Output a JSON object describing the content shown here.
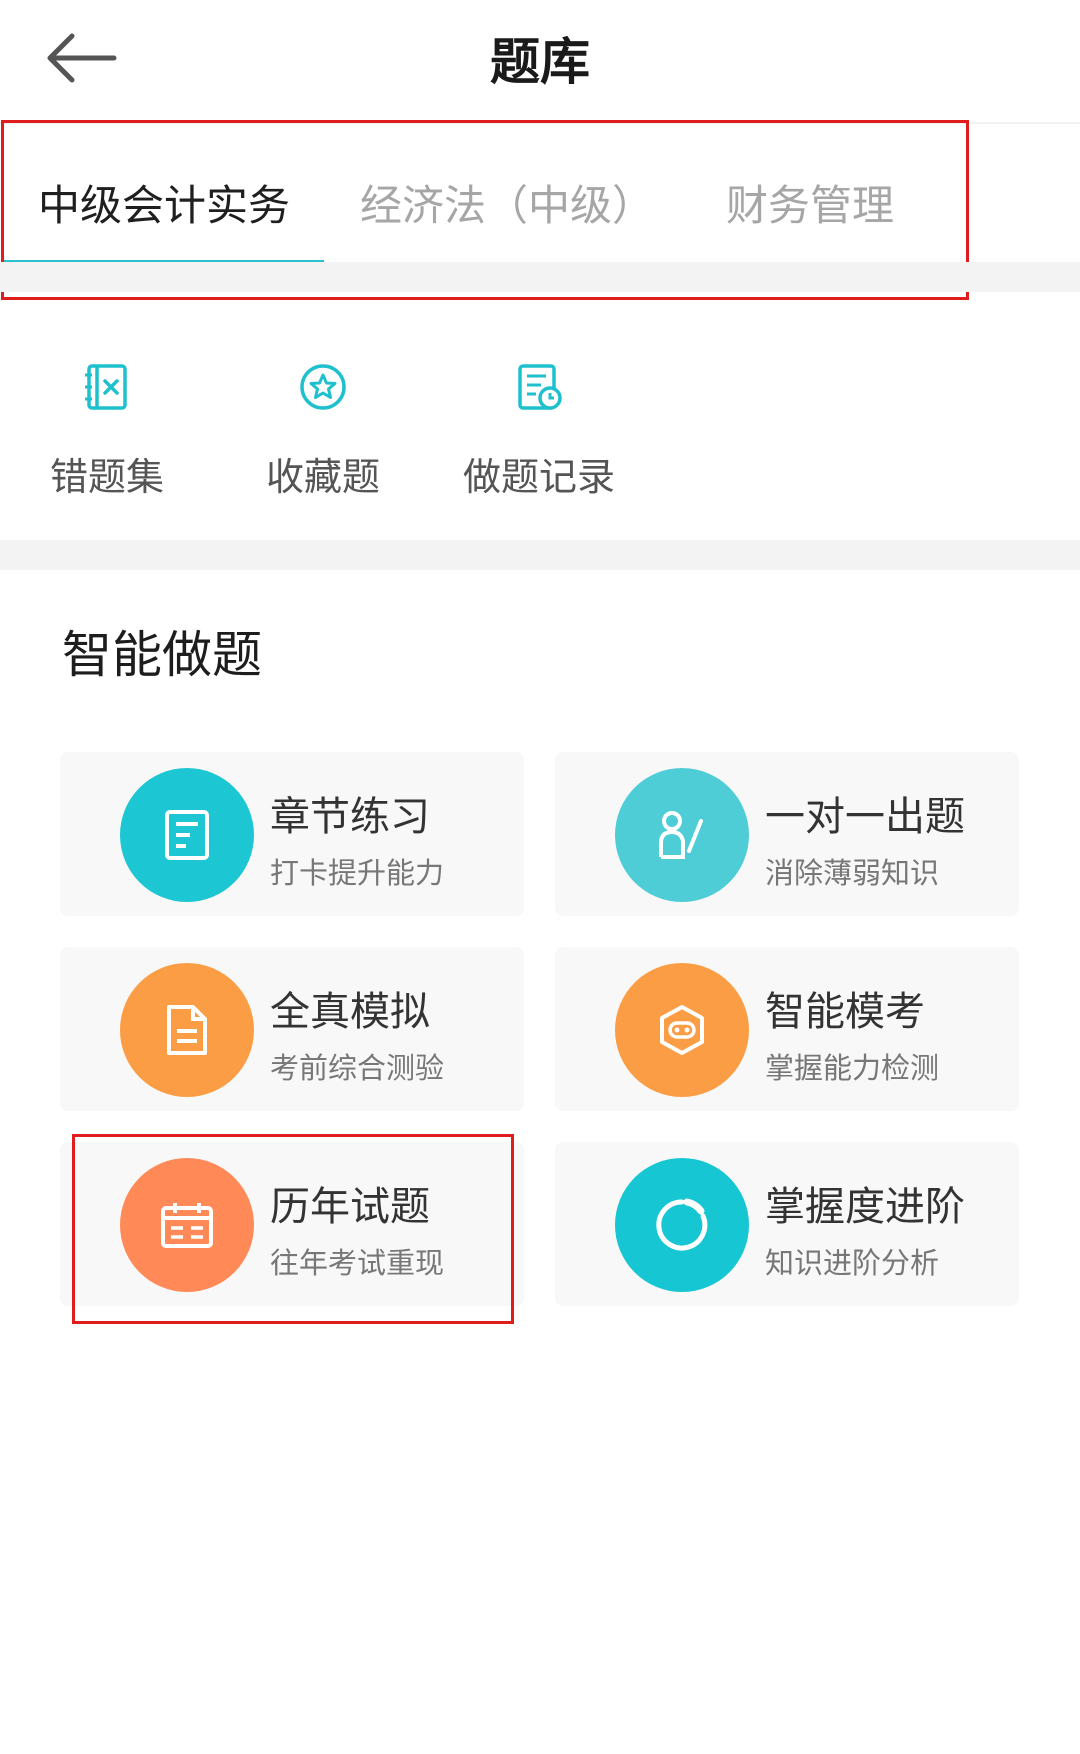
{
  "header": {
    "title": "题库"
  },
  "tabs": [
    {
      "label": "中级会计实务",
      "active": true
    },
    {
      "label": "经济法（中级）",
      "active": false
    },
    {
      "label": "财务管理",
      "active": false
    }
  ],
  "quick_actions": [
    {
      "label": "错题集",
      "icon": "error-notebook-icon"
    },
    {
      "label": "收藏题",
      "icon": "star-circle-icon"
    },
    {
      "label": "做题记录",
      "icon": "record-clock-icon"
    }
  ],
  "section": {
    "title": "智能做题"
  },
  "cards": [
    {
      "title": "章节练习",
      "subtitle": "打卡提升能力",
      "icon": "document-icon",
      "color": "#1cc6d2"
    },
    {
      "title": "一对一出题",
      "subtitle": "消除薄弱知识",
      "icon": "person-pen-icon",
      "color": "#4fcdd6"
    },
    {
      "title": "全真模拟",
      "subtitle": "考前综合测验",
      "icon": "file-icon",
      "color": "#fb9d45"
    },
    {
      "title": "智能模考",
      "subtitle": "掌握能力检测",
      "icon": "robot-hexagon-icon",
      "color": "#fb9d45"
    },
    {
      "title": "历年试题",
      "subtitle": "往年考试重现",
      "icon": "calendar-icon",
      "color": "#ff8a57"
    },
    {
      "title": "掌握度进阶",
      "subtitle": "知识进阶分析",
      "icon": "progress-ring-icon",
      "color": "#16c6d2"
    }
  ],
  "colors": {
    "accent": "#2bbfcf",
    "highlight_border": "#e01d1d"
  }
}
